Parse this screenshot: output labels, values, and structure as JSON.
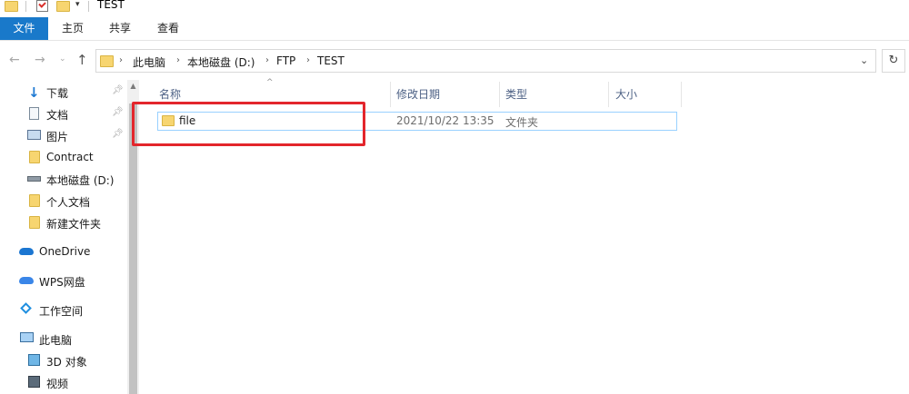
{
  "window": {
    "title": "TEST"
  },
  "ribbon": {
    "tabs": [
      "文件",
      "主页",
      "共享",
      "查看"
    ]
  },
  "address": {
    "crumbs": [
      "此电脑",
      "本地磁盘 (D:)",
      "FTP",
      "TEST"
    ]
  },
  "sidebar": {
    "quick_access": [
      {
        "label": "下载",
        "icon": "download-icon",
        "pinned": true
      },
      {
        "label": "文档",
        "icon": "document-icon",
        "pinned": true
      },
      {
        "label": "图片",
        "icon": "picture-icon",
        "pinned": true
      },
      {
        "label": "Contract",
        "icon": "folder-icon",
        "pinned": false
      },
      {
        "label": "本地磁盘 (D:)",
        "icon": "drive-icon",
        "pinned": false
      },
      {
        "label": "个人文档",
        "icon": "folder-icon",
        "pinned": false
      },
      {
        "label": "新建文件夹",
        "icon": "folder-icon",
        "pinned": false
      }
    ],
    "onedrive": "OneDrive",
    "wps": "WPS网盘",
    "workspace": "工作空间",
    "this_pc": "此电脑",
    "pc_items": [
      {
        "label": "3D 对象",
        "icon": "3d-objects-icon"
      },
      {
        "label": "视频",
        "icon": "video-icon"
      }
    ]
  },
  "columns": {
    "name": "名称",
    "modified": "修改日期",
    "type": "类型",
    "size": "大小"
  },
  "files": [
    {
      "name": "file",
      "modified": "2021/10/22 13:35",
      "type": "文件夹",
      "size": ""
    }
  ],
  "colors": {
    "accent": "#1979ca",
    "highlight": "#e3262c",
    "selection_border": "#99d1ff",
    "folder": "#f7d570"
  }
}
